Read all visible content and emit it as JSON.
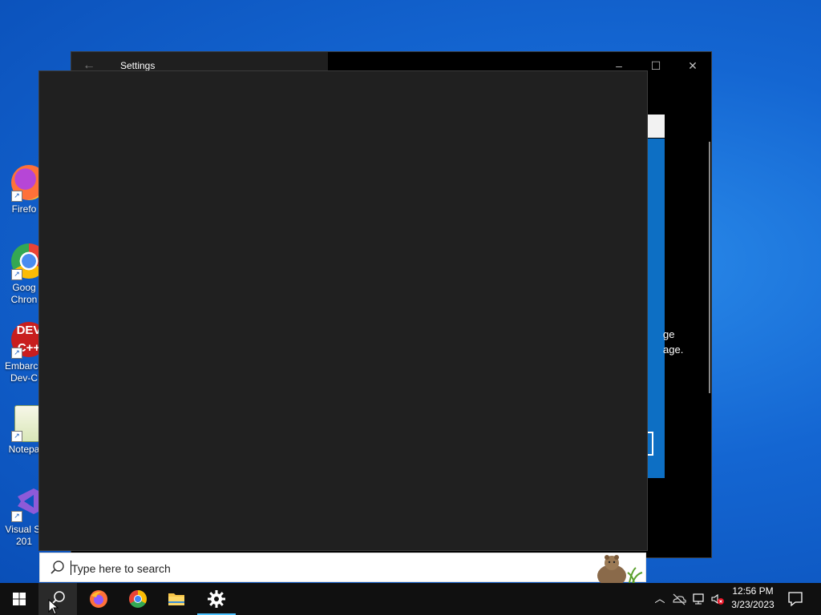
{
  "desktop": {
    "icons": [
      {
        "label": "Firefo",
        "icon": "firefox-icon"
      },
      {
        "label": "Goog Chron",
        "icon": "chrome-icon"
      },
      {
        "label": "Embarca Dev-C",
        "icon": "devcpp-icon"
      },
      {
        "label": "Notepa",
        "icon": "notepadpp-icon"
      },
      {
        "label": "Visual St 201",
        "icon": "visual-studio-icon"
      }
    ]
  },
  "settings_window": {
    "title": "Settings",
    "panel_text_line1": "ge",
    "panel_text_line2": "age."
  },
  "search": {
    "placeholder": "Type here to search"
  },
  "taskbar": {
    "items": [
      "start",
      "search",
      "firefox",
      "chrome",
      "file-explorer",
      "settings"
    ],
    "time": "12:56 PM",
    "date": "3/23/2023"
  },
  "colors": {
    "accent": "#4cc2ff",
    "panel_bg": "#202020",
    "desktop_blue": "#1466d2",
    "settings_blue": "#0d6fc4"
  }
}
